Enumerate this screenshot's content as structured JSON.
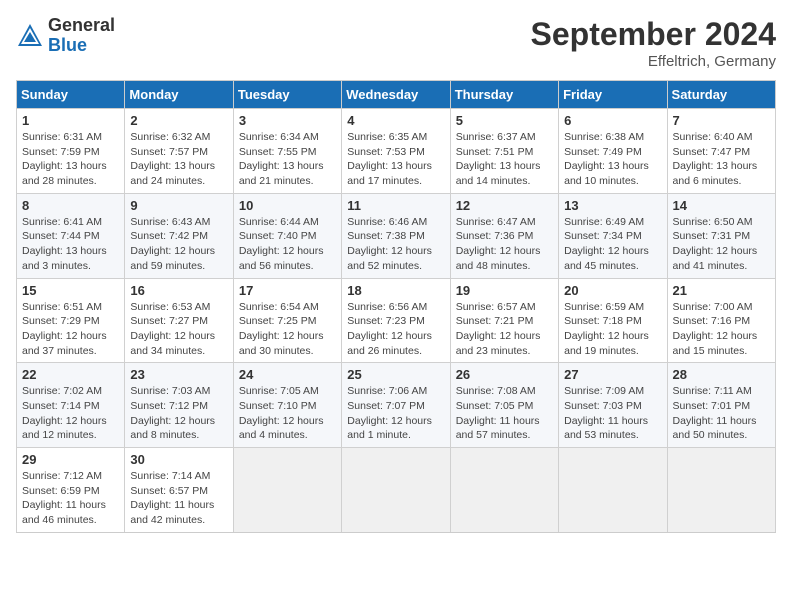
{
  "header": {
    "logo_general": "General",
    "logo_blue": "Blue",
    "month_title": "September 2024",
    "subtitle": "Effeltrich, Germany"
  },
  "days_of_week": [
    "Sunday",
    "Monday",
    "Tuesday",
    "Wednesday",
    "Thursday",
    "Friday",
    "Saturday"
  ],
  "weeks": [
    [
      {
        "day": "1",
        "sunrise": "Sunrise: 6:31 AM",
        "sunset": "Sunset: 7:59 PM",
        "daylight": "Daylight: 13 hours and 28 minutes."
      },
      {
        "day": "2",
        "sunrise": "Sunrise: 6:32 AM",
        "sunset": "Sunset: 7:57 PM",
        "daylight": "Daylight: 13 hours and 24 minutes."
      },
      {
        "day": "3",
        "sunrise": "Sunrise: 6:34 AM",
        "sunset": "Sunset: 7:55 PM",
        "daylight": "Daylight: 13 hours and 21 minutes."
      },
      {
        "day": "4",
        "sunrise": "Sunrise: 6:35 AM",
        "sunset": "Sunset: 7:53 PM",
        "daylight": "Daylight: 13 hours and 17 minutes."
      },
      {
        "day": "5",
        "sunrise": "Sunrise: 6:37 AM",
        "sunset": "Sunset: 7:51 PM",
        "daylight": "Daylight: 13 hours and 14 minutes."
      },
      {
        "day": "6",
        "sunrise": "Sunrise: 6:38 AM",
        "sunset": "Sunset: 7:49 PM",
        "daylight": "Daylight: 13 hours and 10 minutes."
      },
      {
        "day": "7",
        "sunrise": "Sunrise: 6:40 AM",
        "sunset": "Sunset: 7:47 PM",
        "daylight": "Daylight: 13 hours and 6 minutes."
      }
    ],
    [
      {
        "day": "8",
        "sunrise": "Sunrise: 6:41 AM",
        "sunset": "Sunset: 7:44 PM",
        "daylight": "Daylight: 13 hours and 3 minutes."
      },
      {
        "day": "9",
        "sunrise": "Sunrise: 6:43 AM",
        "sunset": "Sunset: 7:42 PM",
        "daylight": "Daylight: 12 hours and 59 minutes."
      },
      {
        "day": "10",
        "sunrise": "Sunrise: 6:44 AM",
        "sunset": "Sunset: 7:40 PM",
        "daylight": "Daylight: 12 hours and 56 minutes."
      },
      {
        "day": "11",
        "sunrise": "Sunrise: 6:46 AM",
        "sunset": "Sunset: 7:38 PM",
        "daylight": "Daylight: 12 hours and 52 minutes."
      },
      {
        "day": "12",
        "sunrise": "Sunrise: 6:47 AM",
        "sunset": "Sunset: 7:36 PM",
        "daylight": "Daylight: 12 hours and 48 minutes."
      },
      {
        "day": "13",
        "sunrise": "Sunrise: 6:49 AM",
        "sunset": "Sunset: 7:34 PM",
        "daylight": "Daylight: 12 hours and 45 minutes."
      },
      {
        "day": "14",
        "sunrise": "Sunrise: 6:50 AM",
        "sunset": "Sunset: 7:31 PM",
        "daylight": "Daylight: 12 hours and 41 minutes."
      }
    ],
    [
      {
        "day": "15",
        "sunrise": "Sunrise: 6:51 AM",
        "sunset": "Sunset: 7:29 PM",
        "daylight": "Daylight: 12 hours and 37 minutes."
      },
      {
        "day": "16",
        "sunrise": "Sunrise: 6:53 AM",
        "sunset": "Sunset: 7:27 PM",
        "daylight": "Daylight: 12 hours and 34 minutes."
      },
      {
        "day": "17",
        "sunrise": "Sunrise: 6:54 AM",
        "sunset": "Sunset: 7:25 PM",
        "daylight": "Daylight: 12 hours and 30 minutes."
      },
      {
        "day": "18",
        "sunrise": "Sunrise: 6:56 AM",
        "sunset": "Sunset: 7:23 PM",
        "daylight": "Daylight: 12 hours and 26 minutes."
      },
      {
        "day": "19",
        "sunrise": "Sunrise: 6:57 AM",
        "sunset": "Sunset: 7:21 PM",
        "daylight": "Daylight: 12 hours and 23 minutes."
      },
      {
        "day": "20",
        "sunrise": "Sunrise: 6:59 AM",
        "sunset": "Sunset: 7:18 PM",
        "daylight": "Daylight: 12 hours and 19 minutes."
      },
      {
        "day": "21",
        "sunrise": "Sunrise: 7:00 AM",
        "sunset": "Sunset: 7:16 PM",
        "daylight": "Daylight: 12 hours and 15 minutes."
      }
    ],
    [
      {
        "day": "22",
        "sunrise": "Sunrise: 7:02 AM",
        "sunset": "Sunset: 7:14 PM",
        "daylight": "Daylight: 12 hours and 12 minutes."
      },
      {
        "day": "23",
        "sunrise": "Sunrise: 7:03 AM",
        "sunset": "Sunset: 7:12 PM",
        "daylight": "Daylight: 12 hours and 8 minutes."
      },
      {
        "day": "24",
        "sunrise": "Sunrise: 7:05 AM",
        "sunset": "Sunset: 7:10 PM",
        "daylight": "Daylight: 12 hours and 4 minutes."
      },
      {
        "day": "25",
        "sunrise": "Sunrise: 7:06 AM",
        "sunset": "Sunset: 7:07 PM",
        "daylight": "Daylight: 12 hours and 1 minute."
      },
      {
        "day": "26",
        "sunrise": "Sunrise: 7:08 AM",
        "sunset": "Sunset: 7:05 PM",
        "daylight": "Daylight: 11 hours and 57 minutes."
      },
      {
        "day": "27",
        "sunrise": "Sunrise: 7:09 AM",
        "sunset": "Sunset: 7:03 PM",
        "daylight": "Daylight: 11 hours and 53 minutes."
      },
      {
        "day": "28",
        "sunrise": "Sunrise: 7:11 AM",
        "sunset": "Sunset: 7:01 PM",
        "daylight": "Daylight: 11 hours and 50 minutes."
      }
    ],
    [
      {
        "day": "29",
        "sunrise": "Sunrise: 7:12 AM",
        "sunset": "Sunset: 6:59 PM",
        "daylight": "Daylight: 11 hours and 46 minutes."
      },
      {
        "day": "30",
        "sunrise": "Sunrise: 7:14 AM",
        "sunset": "Sunset: 6:57 PM",
        "daylight": "Daylight: 11 hours and 42 minutes."
      },
      null,
      null,
      null,
      null,
      null
    ]
  ]
}
